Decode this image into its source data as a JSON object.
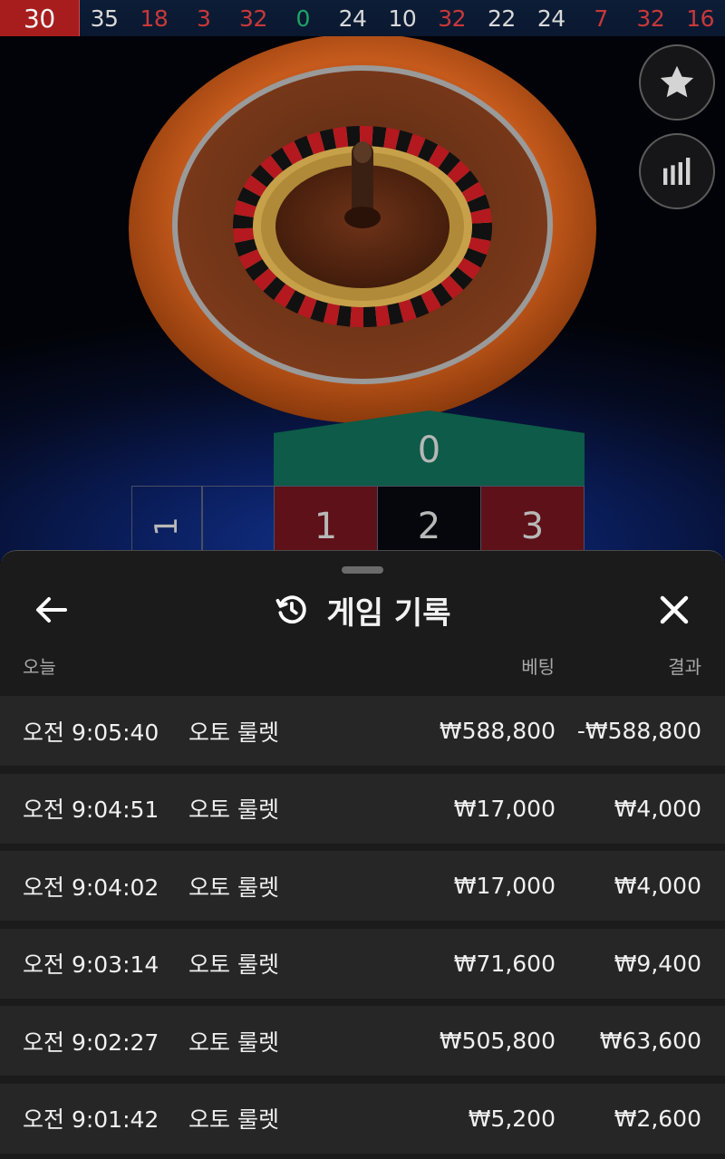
{
  "history": [
    {
      "n": "30",
      "color": "red"
    },
    {
      "n": "35",
      "color": "black"
    },
    {
      "n": "18",
      "color": "red"
    },
    {
      "n": "3",
      "color": "red"
    },
    {
      "n": "32",
      "color": "red"
    },
    {
      "n": "0",
      "color": "green"
    },
    {
      "n": "24",
      "color": "black"
    },
    {
      "n": "10",
      "color": "black"
    },
    {
      "n": "32",
      "color": "red"
    },
    {
      "n": "22",
      "color": "black"
    },
    {
      "n": "24",
      "color": "black"
    },
    {
      "n": "7",
      "color": "red"
    },
    {
      "n": "32",
      "color": "red"
    },
    {
      "n": "16",
      "color": "red"
    }
  ],
  "table": {
    "zero": "0",
    "cells": [
      "1",
      "2",
      "3"
    ],
    "left_cell": "1"
  },
  "icons": {
    "favorite": "star-icon",
    "stats": "bar-chart-icon",
    "back": "arrow-left-icon",
    "history": "history-icon",
    "close": "close-icon"
  },
  "sheet": {
    "title": "게임 기록",
    "date_header": "오늘",
    "bet_header": "베팅",
    "result_header": "결과"
  },
  "records": [
    {
      "time": "오전 9:05:40",
      "game": "오토 룰렛",
      "bet": "₩588,800",
      "result": "-₩588,800"
    },
    {
      "time": "오전 9:04:51",
      "game": "오토 룰렛",
      "bet": "₩17,000",
      "result": "₩4,000"
    },
    {
      "time": "오전 9:04:02",
      "game": "오토 룰렛",
      "bet": "₩17,000",
      "result": "₩4,000"
    },
    {
      "time": "오전 9:03:14",
      "game": "오토 룰렛",
      "bet": "₩71,600",
      "result": "₩9,400"
    },
    {
      "time": "오전 9:02:27",
      "game": "오토 룰렛",
      "bet": "₩505,800",
      "result": "₩63,600"
    },
    {
      "time": "오전 9:01:42",
      "game": "오토 룰렛",
      "bet": "₩5,200",
      "result": "₩2,600"
    }
  ],
  "colors": {
    "red": "#c8383a",
    "green": "#1fa466",
    "sheet_bg": "#1b1b1b",
    "row_bg": "#262626"
  }
}
